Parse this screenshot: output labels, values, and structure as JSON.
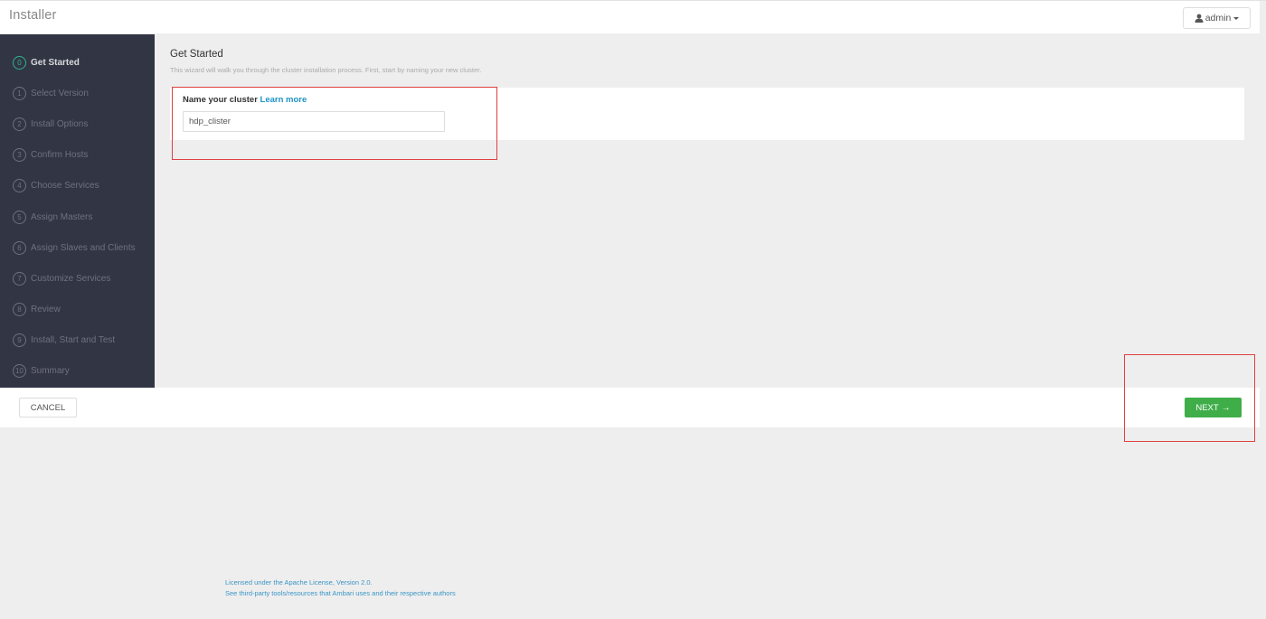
{
  "header": {
    "app_title": "Installer",
    "user_menu": {
      "label": "admin",
      "icon": "user-icon"
    }
  },
  "sidebar": {
    "steps": [
      {
        "num": "0",
        "label": "Get Started",
        "active": true
      },
      {
        "num": "1",
        "label": "Select Version",
        "active": false
      },
      {
        "num": "2",
        "label": "Install Options",
        "active": false
      },
      {
        "num": "3",
        "label": "Confirm Hosts",
        "active": false
      },
      {
        "num": "4",
        "label": "Choose Services",
        "active": false
      },
      {
        "num": "5",
        "label": "Assign Masters",
        "active": false
      },
      {
        "num": "6",
        "label": "Assign Slaves and Clients",
        "active": false
      },
      {
        "num": "7",
        "label": "Customize Services",
        "active": false
      },
      {
        "num": "8",
        "label": "Review",
        "active": false
      },
      {
        "num": "9",
        "label": "Install, Start and Test",
        "active": false
      },
      {
        "num": "10",
        "label": "Summary",
        "active": false
      }
    ]
  },
  "main": {
    "title": "Get Started",
    "subtitle": "This wizard will walk you through the cluster installation process. First, start by naming your new cluster.",
    "field_label": "Name your cluster",
    "learn_more": "Learn more",
    "cluster_name_value": "hdp_clister"
  },
  "footer": {
    "cancel_label": "CANCEL",
    "next_label": "NEXT",
    "next_arrow": "→"
  },
  "legal": {
    "license": "Licensed under the Apache License, Version 2.0.",
    "third_party": "See third-party tools/resources that Ambari uses and their respective authors"
  },
  "colors": {
    "sidebar_bg": "#323544",
    "active_step": "#2db38d",
    "next_button": "#3fae49",
    "link": "#1e93c6",
    "highlight": "#e04040"
  }
}
